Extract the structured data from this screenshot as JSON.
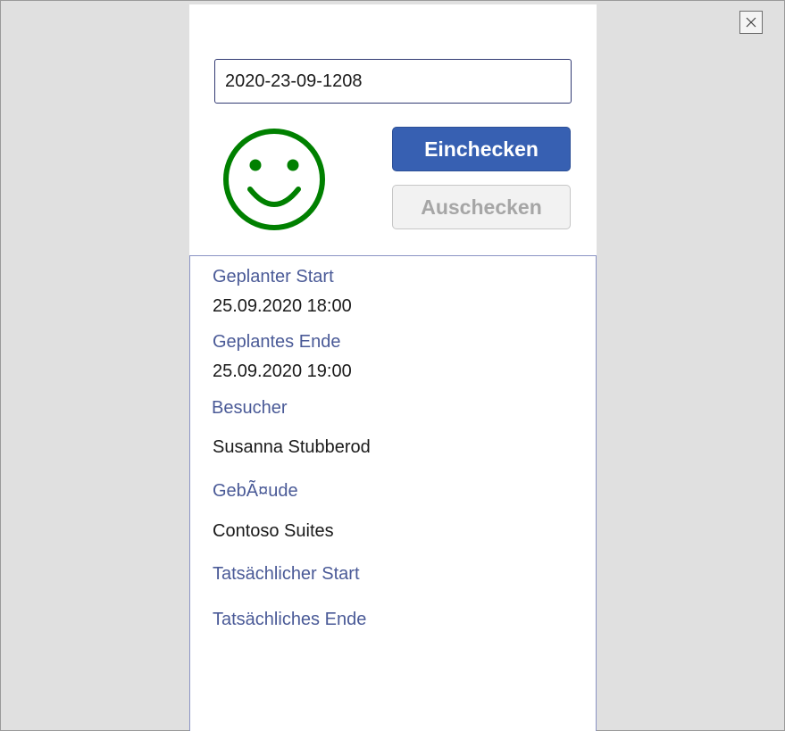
{
  "window": {
    "close_icon": "close-icon"
  },
  "checkin": {
    "code_value": "2020-23-09-1208",
    "status_icon": "smiley-face-icon",
    "status_color": "#008000",
    "checkin_label": "Einchecken",
    "checkout_label": "Auschecken",
    "checkin_color": "#3760b2"
  },
  "details": {
    "planned_start_label": "Geplanter Start",
    "planned_start_value": "25.09.2020 18:00",
    "planned_end_label": "Geplantes Ende",
    "planned_end_value": "25.09.2020 19:00",
    "visitor_label": "Besucher",
    "visitor_value": "Susanna Stubberod",
    "building_label": "GebÃ¤ude",
    "building_value": "Contoso Suites",
    "actual_start_label": "Tatsächlicher Start",
    "actual_end_label": "Tatsächliches Ende"
  }
}
